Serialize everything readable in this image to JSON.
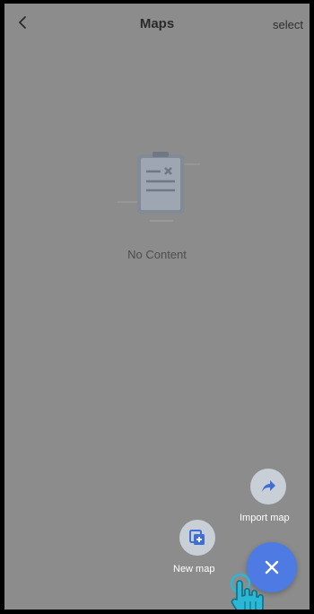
{
  "header": {
    "title": "Maps",
    "select_label": "select"
  },
  "empty_state": {
    "text": "No Content",
    "icon": "empty-clipboard-icon"
  },
  "fab_menu": {
    "items": [
      {
        "label": "Import map",
        "icon": "share-arrow-icon"
      },
      {
        "label": "New map",
        "icon": "new-map-icon"
      }
    ],
    "main_icon": "close-icon"
  },
  "colors": {
    "overlay": "#8c8c8c",
    "accent": "#4d7be3",
    "mini_fab_bg": "#c9cfd6"
  }
}
